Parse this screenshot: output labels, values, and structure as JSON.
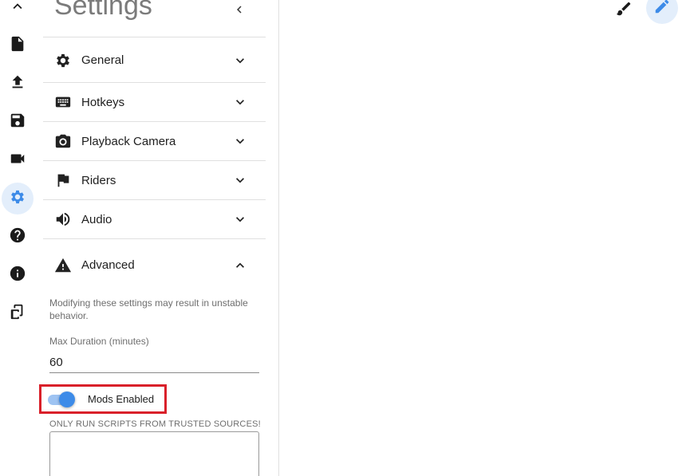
{
  "panel": {
    "title": "Settings",
    "sections": [
      {
        "label": "General",
        "icon": "gear-icon",
        "expanded": false
      },
      {
        "label": "Hotkeys",
        "icon": "keyboard-icon",
        "expanded": false
      },
      {
        "label": "Playback Camera",
        "icon": "camera-icon",
        "expanded": false
      },
      {
        "label": "Riders",
        "icon": "flag-icon",
        "expanded": false
      },
      {
        "label": "Audio",
        "icon": "volume-icon",
        "expanded": false
      },
      {
        "label": "Advanced",
        "icon": "warning-icon",
        "expanded": true
      }
    ],
    "advanced": {
      "note": "Modifying these settings may result in unstable behavior.",
      "max_duration_label": "Max Duration (minutes)",
      "max_duration_value": "60",
      "mods_label": "Mods Enabled",
      "mods_enabled": true,
      "scripts_warning": "ONLY RUN SCRIPTS FROM TRUSTED SOURCES!",
      "script_value": ""
    }
  },
  "rail": {
    "items": [
      "chevron-up-icon",
      "file-icon",
      "upload-icon",
      "save-icon",
      "video-icon",
      "gear-icon",
      "help-icon",
      "info-icon",
      "phone-rotate-icon"
    ],
    "active": "gear-icon"
  },
  "toolbar": {
    "tools": [
      "brush-icon",
      "pencil-icon"
    ],
    "active": "pencil-icon"
  },
  "colors": {
    "accent": "#3d8be8",
    "accent_light": "#e3eefb",
    "highlight_box": "#d9202a",
    "title_gray": "#7b7b7b"
  }
}
